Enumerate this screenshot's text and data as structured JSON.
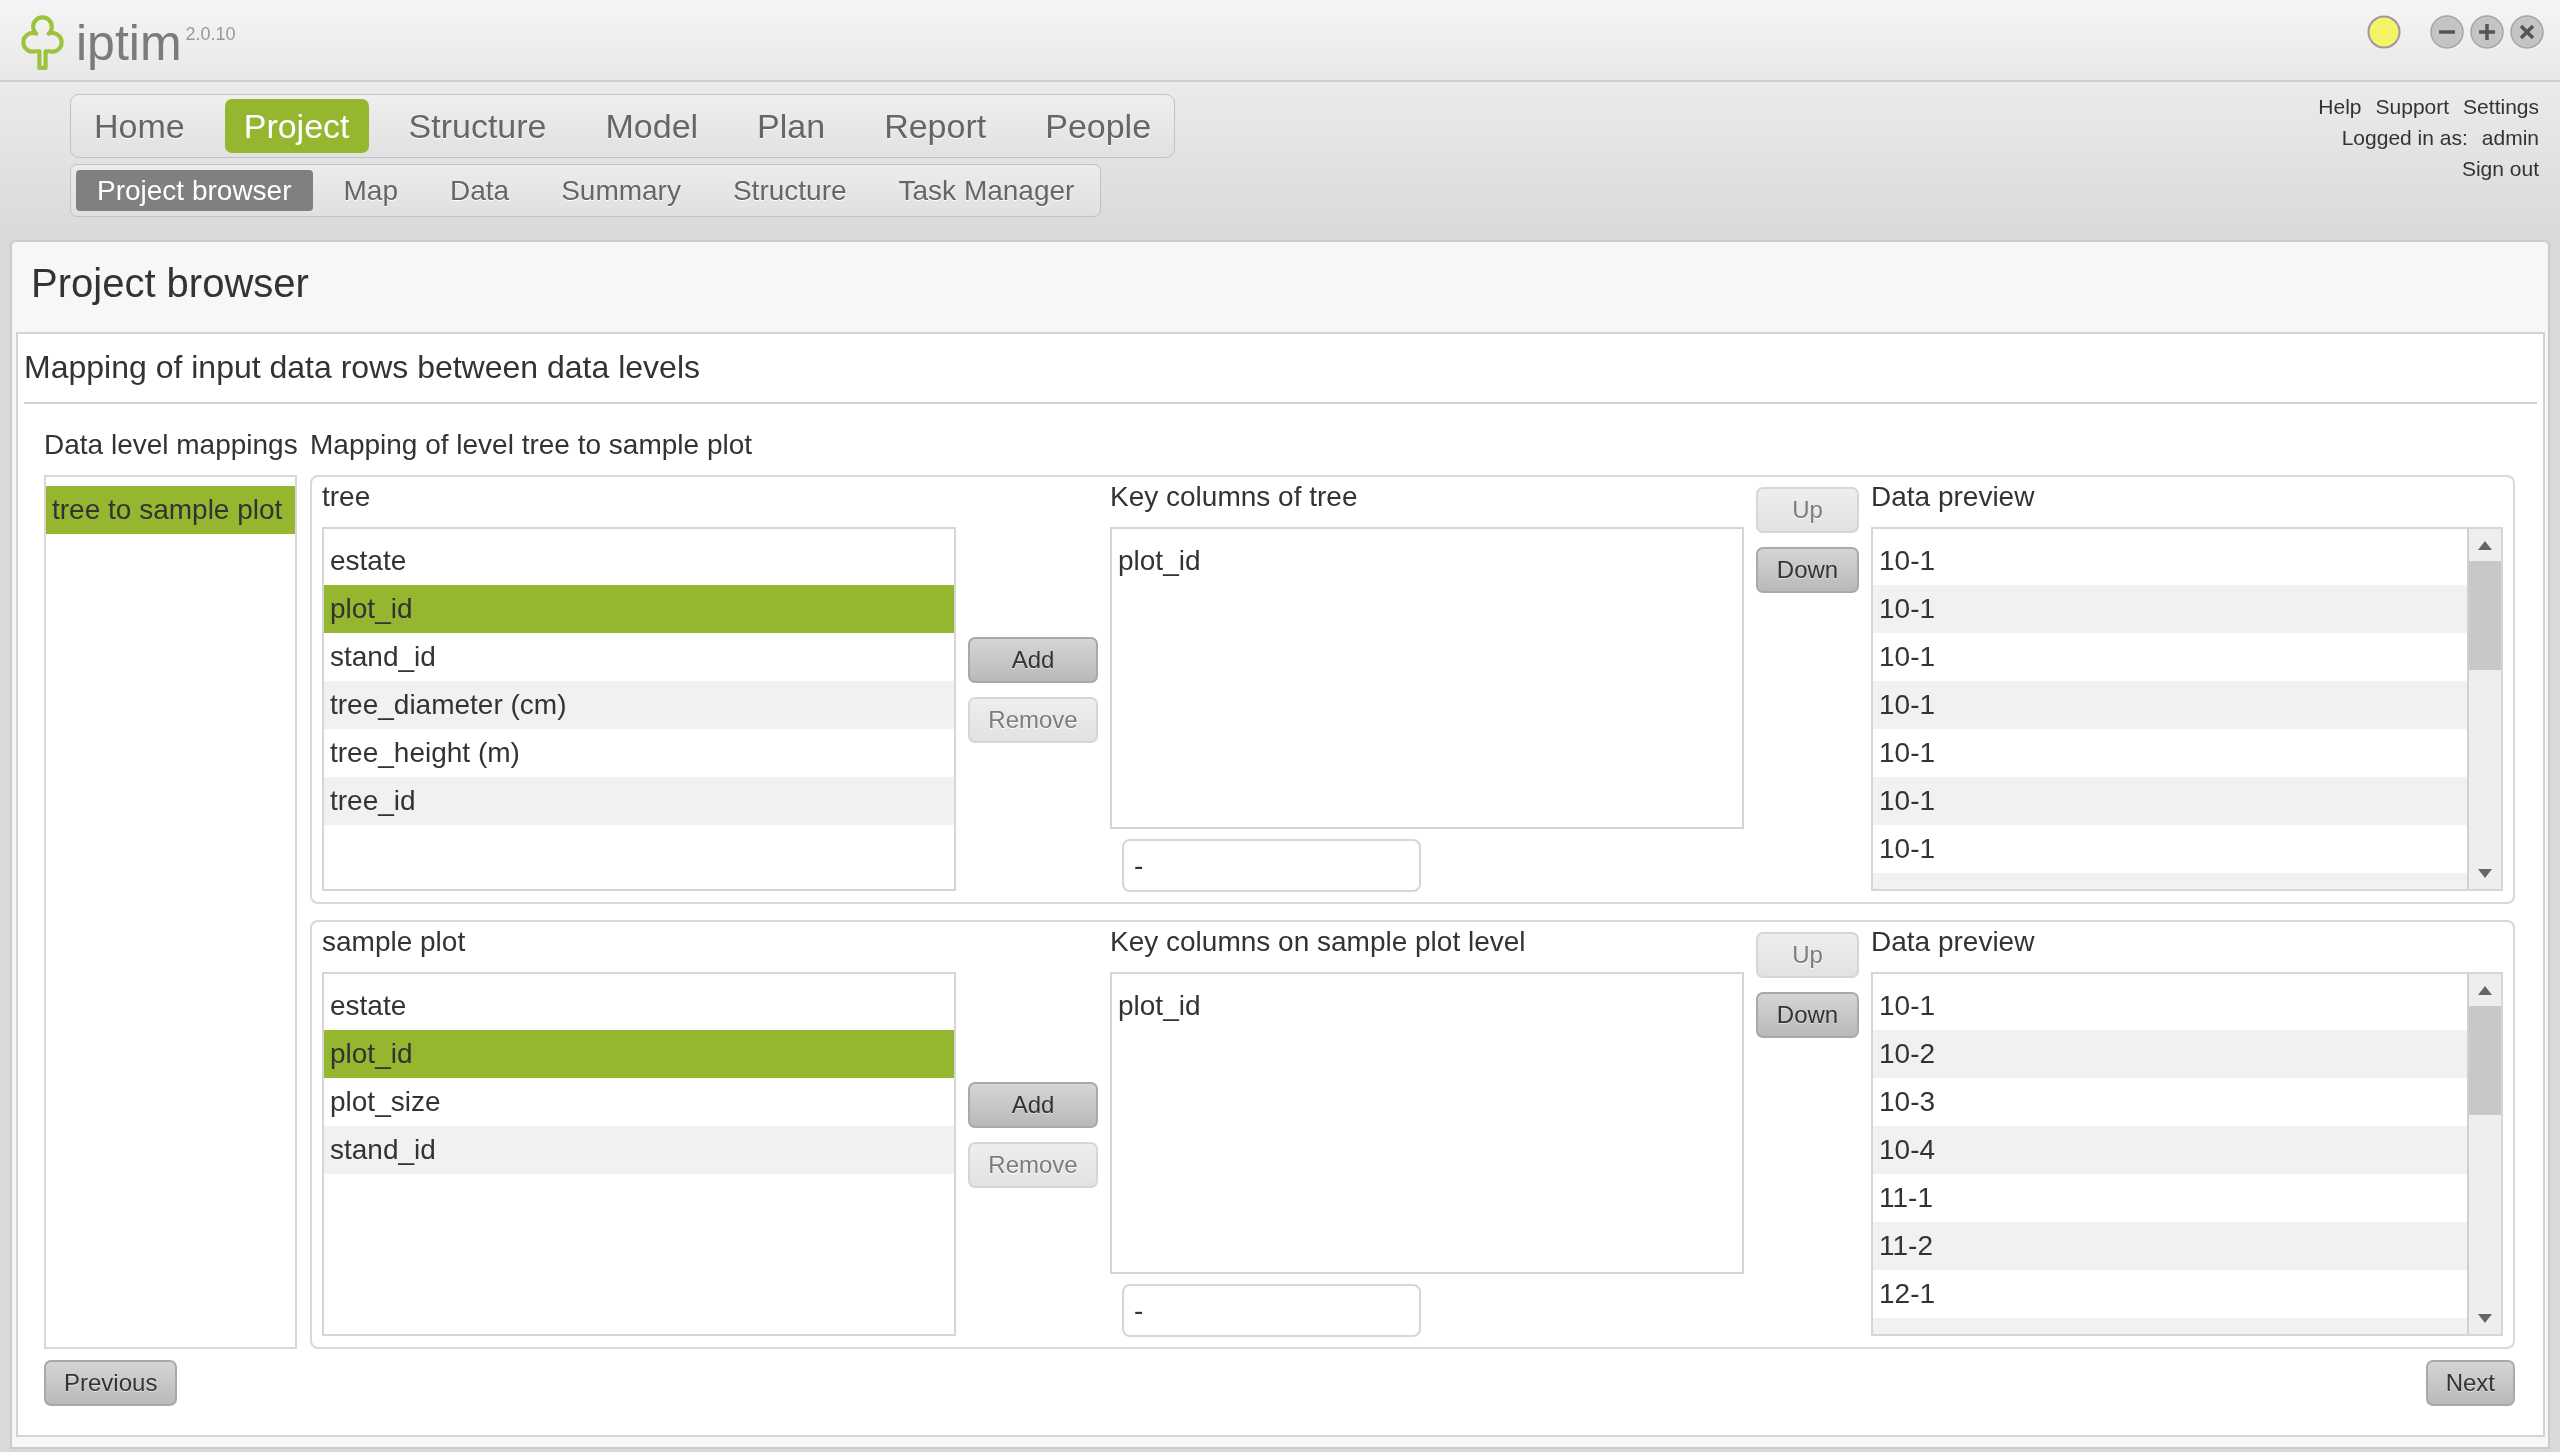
{
  "app": {
    "name": "iptim",
    "version": "2.0.10"
  },
  "main_nav": [
    {
      "label": "Home",
      "selected": false
    },
    {
      "label": "Project",
      "selected": true
    },
    {
      "label": "Structure",
      "selected": false
    },
    {
      "label": "Model",
      "selected": false
    },
    {
      "label": "Plan",
      "selected": false
    },
    {
      "label": "Report",
      "selected": false
    },
    {
      "label": "People",
      "selected": false
    }
  ],
  "sub_nav": [
    {
      "label": "Project browser",
      "selected": true
    },
    {
      "label": "Map",
      "selected": false
    },
    {
      "label": "Data",
      "selected": false
    },
    {
      "label": "Summary",
      "selected": false
    },
    {
      "label": "Structure",
      "selected": false
    },
    {
      "label": "Task Manager",
      "selected": false
    }
  ],
  "user_menu": {
    "links": [
      "Help",
      "Support",
      "Settings"
    ],
    "logged_in_label": "Logged in as:",
    "user": "admin",
    "sign_out": "Sign out"
  },
  "page": {
    "title": "Project browser",
    "section_title": "Mapping of input data rows between data levels",
    "mappings_label": "Data level mappings",
    "mappings": [
      {
        "label": "tree to sample plot",
        "selected": true
      }
    ],
    "mapping_title": "Mapping of level tree to sample plot",
    "levels": [
      {
        "name": "tree",
        "columns": [
          {
            "label": "estate",
            "selected": false
          },
          {
            "label": "plot_id",
            "selected": true
          },
          {
            "label": "stand_id",
            "selected": false
          },
          {
            "label": "tree_diameter (cm)",
            "selected": false
          },
          {
            "label": "tree_height (m)",
            "selected": false
          },
          {
            "label": "tree_id",
            "selected": false
          }
        ],
        "buttons": [
          {
            "label": "Add",
            "disabled": false
          },
          {
            "label": "Remove",
            "disabled": true
          }
        ],
        "key_columns_label": "Key columns of tree",
        "key_columns": [
          "plot_id"
        ],
        "key_field": "-",
        "order_buttons": [
          {
            "label": "Up",
            "disabled": true
          },
          {
            "label": "Down",
            "disabled": false
          }
        ],
        "preview_label": "Data preview",
        "preview_rows": [
          "10-1",
          "10-1",
          "10-1",
          "10-1",
          "10-1",
          "10-1",
          "10-1"
        ]
      },
      {
        "name": "sample plot",
        "columns": [
          {
            "label": "estate",
            "selected": false
          },
          {
            "label": "plot_id",
            "selected": true
          },
          {
            "label": "plot_size",
            "selected": false
          },
          {
            "label": "stand_id",
            "selected": false
          }
        ],
        "buttons": [
          {
            "label": "Add",
            "disabled": false
          },
          {
            "label": "Remove",
            "disabled": true
          }
        ],
        "key_columns_label": "Key columns on sample plot level",
        "key_columns": [
          "plot_id"
        ],
        "key_field": "-",
        "order_buttons": [
          {
            "label": "Up",
            "disabled": true
          },
          {
            "label": "Down",
            "disabled": false
          }
        ],
        "preview_label": "Data preview",
        "preview_rows": [
          "10-1",
          "10-2",
          "10-3",
          "10-4",
          "11-1",
          "11-2",
          "12-1"
        ]
      }
    ]
  },
  "footer": {
    "previous": "Previous",
    "next": "Next"
  }
}
